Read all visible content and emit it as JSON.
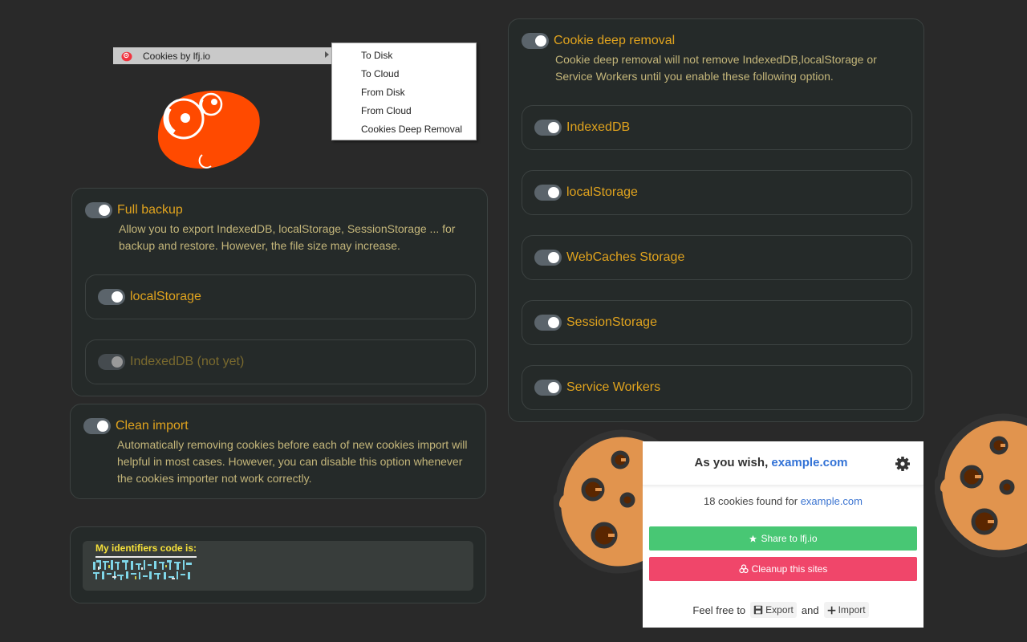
{
  "context_menu": {
    "parent_label": "Cookies by lfj.io",
    "items": [
      "To Disk",
      "To Cloud",
      "From Disk",
      "From Cloud",
      "Cookies Deep Removal"
    ]
  },
  "full_backup": {
    "title": "Full backup",
    "enabled": true,
    "description_line1": "Allow you to export IndexedDB, localStorage, SessionStorage ... for",
    "description_line2": "backup and restore. However, the file size may increase.",
    "options": [
      {
        "label": "localStorage",
        "enabled": true,
        "disabled": false
      },
      {
        "label": "IndexedDB (not yet)",
        "enabled": true,
        "disabled": true
      }
    ]
  },
  "clean_import": {
    "title": "Clean import",
    "enabled": true,
    "description_line1": "Automatically removing cookies before each of new cookies import will",
    "description_line2": "helpful in most cases. However, you can disable this option whenever",
    "description_line3": "the cookies importer not work correctly."
  },
  "identifiers": {
    "label": "My identifiers code is:"
  },
  "deep_removal": {
    "title": "Cookie deep removal",
    "enabled": true,
    "description_line1": "Cookie deep removal will not remove IndexedDB,localStorage or",
    "description_line2": "Service Workers until you enable these following option.",
    "options": [
      {
        "label": "IndexedDB",
        "enabled": true
      },
      {
        "label": "localStorage",
        "enabled": true
      },
      {
        "label": "WebCaches Storage",
        "enabled": true
      },
      {
        "label": "SessionStorage",
        "enabled": true
      },
      {
        "label": "Service Workers",
        "enabled": true
      }
    ]
  },
  "popup": {
    "title_prefix": "As you wish,",
    "title_domain": "example.com",
    "found_text": "18 cookies found for",
    "found_domain": "example.com",
    "share_label": "Share to lfj.io",
    "cleanup_label": "Cleanup this sites",
    "feel_free": "Feel free to",
    "export_label": "Export",
    "and_label": "and",
    "import_label": "Import"
  },
  "colors": {
    "accent_title": "#e0a31e",
    "share_green": "#48c774",
    "cleanup_red": "#f0466a",
    "link_blue": "#3272d6",
    "logo_orange": "#ff4a00",
    "cookie_orange": "#e1944e"
  }
}
